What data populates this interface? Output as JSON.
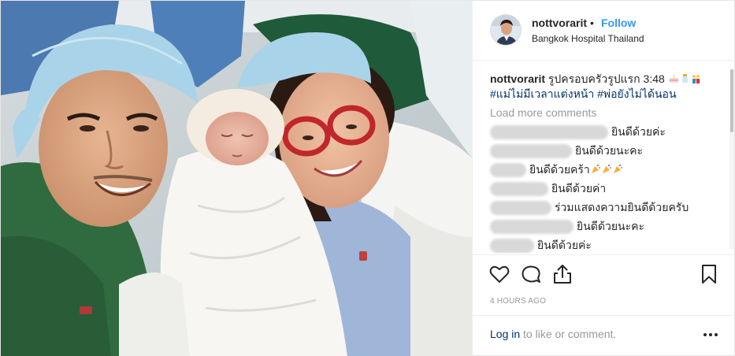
{
  "header": {
    "username": "nottvorarit",
    "separator": "•",
    "follow_label": "Follow",
    "location": "Bangkok Hospital Thailand"
  },
  "caption": {
    "username": "nottvorarit",
    "text": "รูปครอบครัวรูปแรก 3:48",
    "hashtag_1": "#แม่ไม่มีเวลาแต่งหน้า",
    "hashtag_2": "#พ่อยังไม่ได้นอน",
    "emojis": [
      "birthday-cake-emoji",
      "baby-bottle-emoji",
      "family-emoji"
    ]
  },
  "load_more_label": "Load more comments",
  "comments": [
    {
      "text": "ยินดีด้วยค่ะ",
      "emojis": []
    },
    {
      "text": "ยินดีด้วยนะคะ",
      "emojis": []
    },
    {
      "text": "ยินดีด้วยคร้า",
      "emojis": [
        "party-popper-emoji",
        "party-popper-emoji",
        "party-popper-emoji"
      ]
    },
    {
      "text": "ยินดีด้วยค่า",
      "emojis": []
    },
    {
      "text": "ร่วมแสดงความยินดีด้วยครับ",
      "emojis": []
    },
    {
      "text": "ยินดีด้วยนะคะ",
      "emojis": []
    },
    {
      "text": "ยินดีด้วยค่ะ",
      "emojis": []
    }
  ],
  "timestamp": "4 HOURS AGO",
  "footer": {
    "login_label": "Log in",
    "login_suffix": " to like or comment."
  },
  "colors": {
    "link_blue": "#3897f0",
    "hashtag": "#003569",
    "muted": "#999999",
    "border": "#efefef"
  }
}
